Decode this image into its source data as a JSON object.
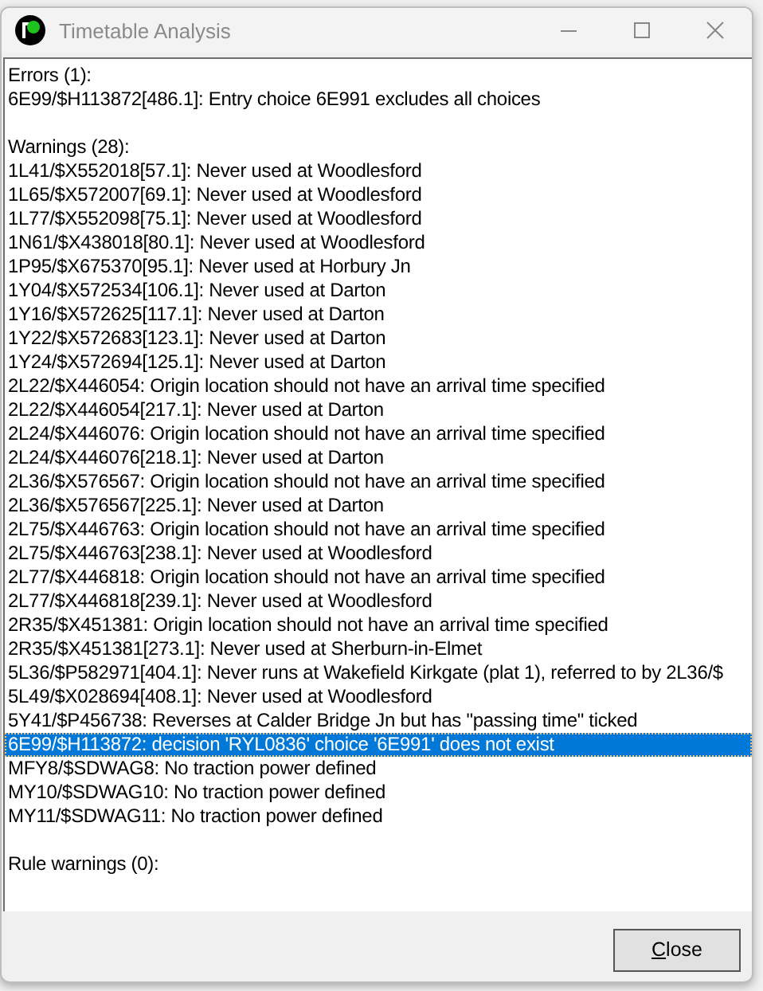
{
  "window": {
    "title": "Timetable Analysis"
  },
  "sections": [
    {
      "heading": "Errors (1):",
      "items": [
        {
          "text": "6E99/$H113872[486.1]: Entry choice 6E991 excludes all choices",
          "selected": false
        }
      ]
    },
    {
      "heading": "Warnings (28):",
      "items": [
        {
          "text": "1L41/$X552018[57.1]: Never used at Woodlesford",
          "selected": false
        },
        {
          "text": "1L65/$X572007[69.1]: Never used at Woodlesford",
          "selected": false
        },
        {
          "text": "1L77/$X552098[75.1]: Never used at Woodlesford",
          "selected": false
        },
        {
          "text": "1N61/$X438018[80.1]: Never used at Woodlesford",
          "selected": false
        },
        {
          "text": "1P95/$X675370[95.1]: Never used at Horbury Jn",
          "selected": false
        },
        {
          "text": "1Y04/$X572534[106.1]: Never used at Darton",
          "selected": false
        },
        {
          "text": "1Y16/$X572625[117.1]: Never used at Darton",
          "selected": false
        },
        {
          "text": "1Y22/$X572683[123.1]: Never used at Darton",
          "selected": false
        },
        {
          "text": "1Y24/$X572694[125.1]: Never used at Darton",
          "selected": false
        },
        {
          "text": "2L22/$X446054: Origin location should not have an arrival time specified",
          "selected": false
        },
        {
          "text": "2L22/$X446054[217.1]: Never used at Darton",
          "selected": false
        },
        {
          "text": "2L24/$X446076: Origin location should not have an arrival time specified",
          "selected": false
        },
        {
          "text": "2L24/$X446076[218.1]: Never used at Darton",
          "selected": false
        },
        {
          "text": "2L36/$X576567: Origin location should not have an arrival time specified",
          "selected": false
        },
        {
          "text": "2L36/$X576567[225.1]: Never used at Darton",
          "selected": false
        },
        {
          "text": "2L75/$X446763: Origin location should not have an arrival time specified",
          "selected": false
        },
        {
          "text": "2L75/$X446763[238.1]: Never used at Woodlesford",
          "selected": false
        },
        {
          "text": "2L77/$X446818: Origin location should not have an arrival time specified",
          "selected": false
        },
        {
          "text": "2L77/$X446818[239.1]: Never used at Woodlesford",
          "selected": false
        },
        {
          "text": "2R35/$X451381: Origin location should not have an arrival time specified",
          "selected": false
        },
        {
          "text": "2R35/$X451381[273.1]: Never used at Sherburn-in-Elmet",
          "selected": false
        },
        {
          "text": "5L36/$P582971[404.1]: Never runs at Wakefield Kirkgate (plat 1), referred to by 2L36/$",
          "selected": false
        },
        {
          "text": "5L49/$X028694[408.1]: Never used at Woodlesford",
          "selected": false
        },
        {
          "text": "5Y41/$P456738: Reverses at Calder Bridge Jn but has \"passing time\" ticked",
          "selected": false
        },
        {
          "text": "6E99/$H113872: decision 'RYL0836' choice '6E991' does not exist",
          "selected": true
        },
        {
          "text": "MFY8/$SDWAG8: No traction power defined",
          "selected": false
        },
        {
          "text": "MY10/$SDWAG10: No traction power defined",
          "selected": false
        },
        {
          "text": "MY11/$SDWAG11: No traction power defined",
          "selected": false
        }
      ]
    },
    {
      "heading": "Rule warnings (0):"
    }
  ],
  "close_button": "Close"
}
